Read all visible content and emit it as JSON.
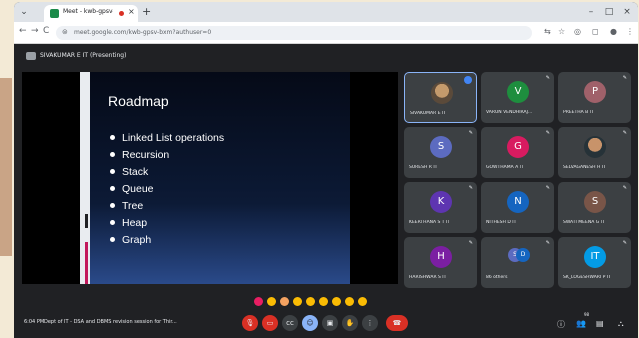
{
  "browser": {
    "tab_title": "Meet - kwb-gpsv-bxm",
    "new_tab_symbol": "+",
    "window_controls": [
      "–",
      "□",
      "×"
    ],
    "url": "meet.google.com/kwb-gpsv-bxm?authuser=0",
    "nav": {
      "back": "←",
      "forward": "→",
      "reload": "C"
    },
    "toolbar_icons": [
      "translate-icon",
      "star-icon",
      "extensions-icon",
      "profile-icon",
      "menu-icon"
    ]
  },
  "meet": {
    "presenter_label": "SIVAKUMAR E IT (Presenting)",
    "slide": {
      "title": "Roadmap",
      "bullets": [
        "Linked List operations",
        "Recursion",
        "Stack",
        "Queue",
        "Tree",
        "Heap",
        "Graph"
      ]
    },
    "participants": [
      {
        "name": "SIVAKUMAR E IT",
        "avatar": "",
        "photo": true,
        "color": "",
        "active": true
      },
      {
        "name": "VARUN VENDHIRAJ...",
        "avatar": "V",
        "photo": false,
        "color": "#1e8e3e"
      },
      {
        "name": "PREETHA B IT",
        "avatar": "P",
        "photo": false,
        "color": "#a0616a"
      },
      {
        "name": "SURESH R IT",
        "avatar": "S",
        "photo": false,
        "color": "#5c6bc0"
      },
      {
        "name": "GOWTHAMA A IT",
        "avatar": "G",
        "photo": false,
        "color": "#d81b60"
      },
      {
        "name": "SELVAGANESH H IT",
        "avatar": "",
        "photo": true,
        "color": ""
      },
      {
        "name": "KEERTHANA S T IT",
        "avatar": "K",
        "photo": false,
        "color": "#5e35b1"
      },
      {
        "name": "NITHESH D IT",
        "avatar": "N",
        "photo": false,
        "color": "#1565c0"
      },
      {
        "name": "SWATI MEENA G IT",
        "avatar": "S",
        "photo": false,
        "color": "#795548"
      },
      {
        "name": "HARISHWAR S IT",
        "avatar": "H",
        "photo": false,
        "color": "#7b1fa2"
      },
      {
        "name": "86 others",
        "avatar": "",
        "photo": false,
        "color": "",
        "others": true
      },
      {
        "name": "SK_LOGESHWARI P IT",
        "avatar": "IT",
        "photo": false,
        "color": "#039be5"
      }
    ],
    "others_avatars": [
      "S",
      "D"
    ],
    "reactions": [
      "heart-emoji",
      "thumbs-up-emoji",
      "party-emoji",
      "clap-emoji",
      "laugh-emoji",
      "surprised-emoji",
      "sad-emoji",
      "thinking-emoji",
      "thumbs-down-emoji"
    ],
    "time": "6:04 PM",
    "meeting_title": "Dept of IT - DSA and DBMS revision session for Thir...",
    "participant_count": "98",
    "colors": {
      "background": "#202124",
      "tile": "#3c4043",
      "danger": "#d93025",
      "accent": "#8ab4f8"
    }
  }
}
